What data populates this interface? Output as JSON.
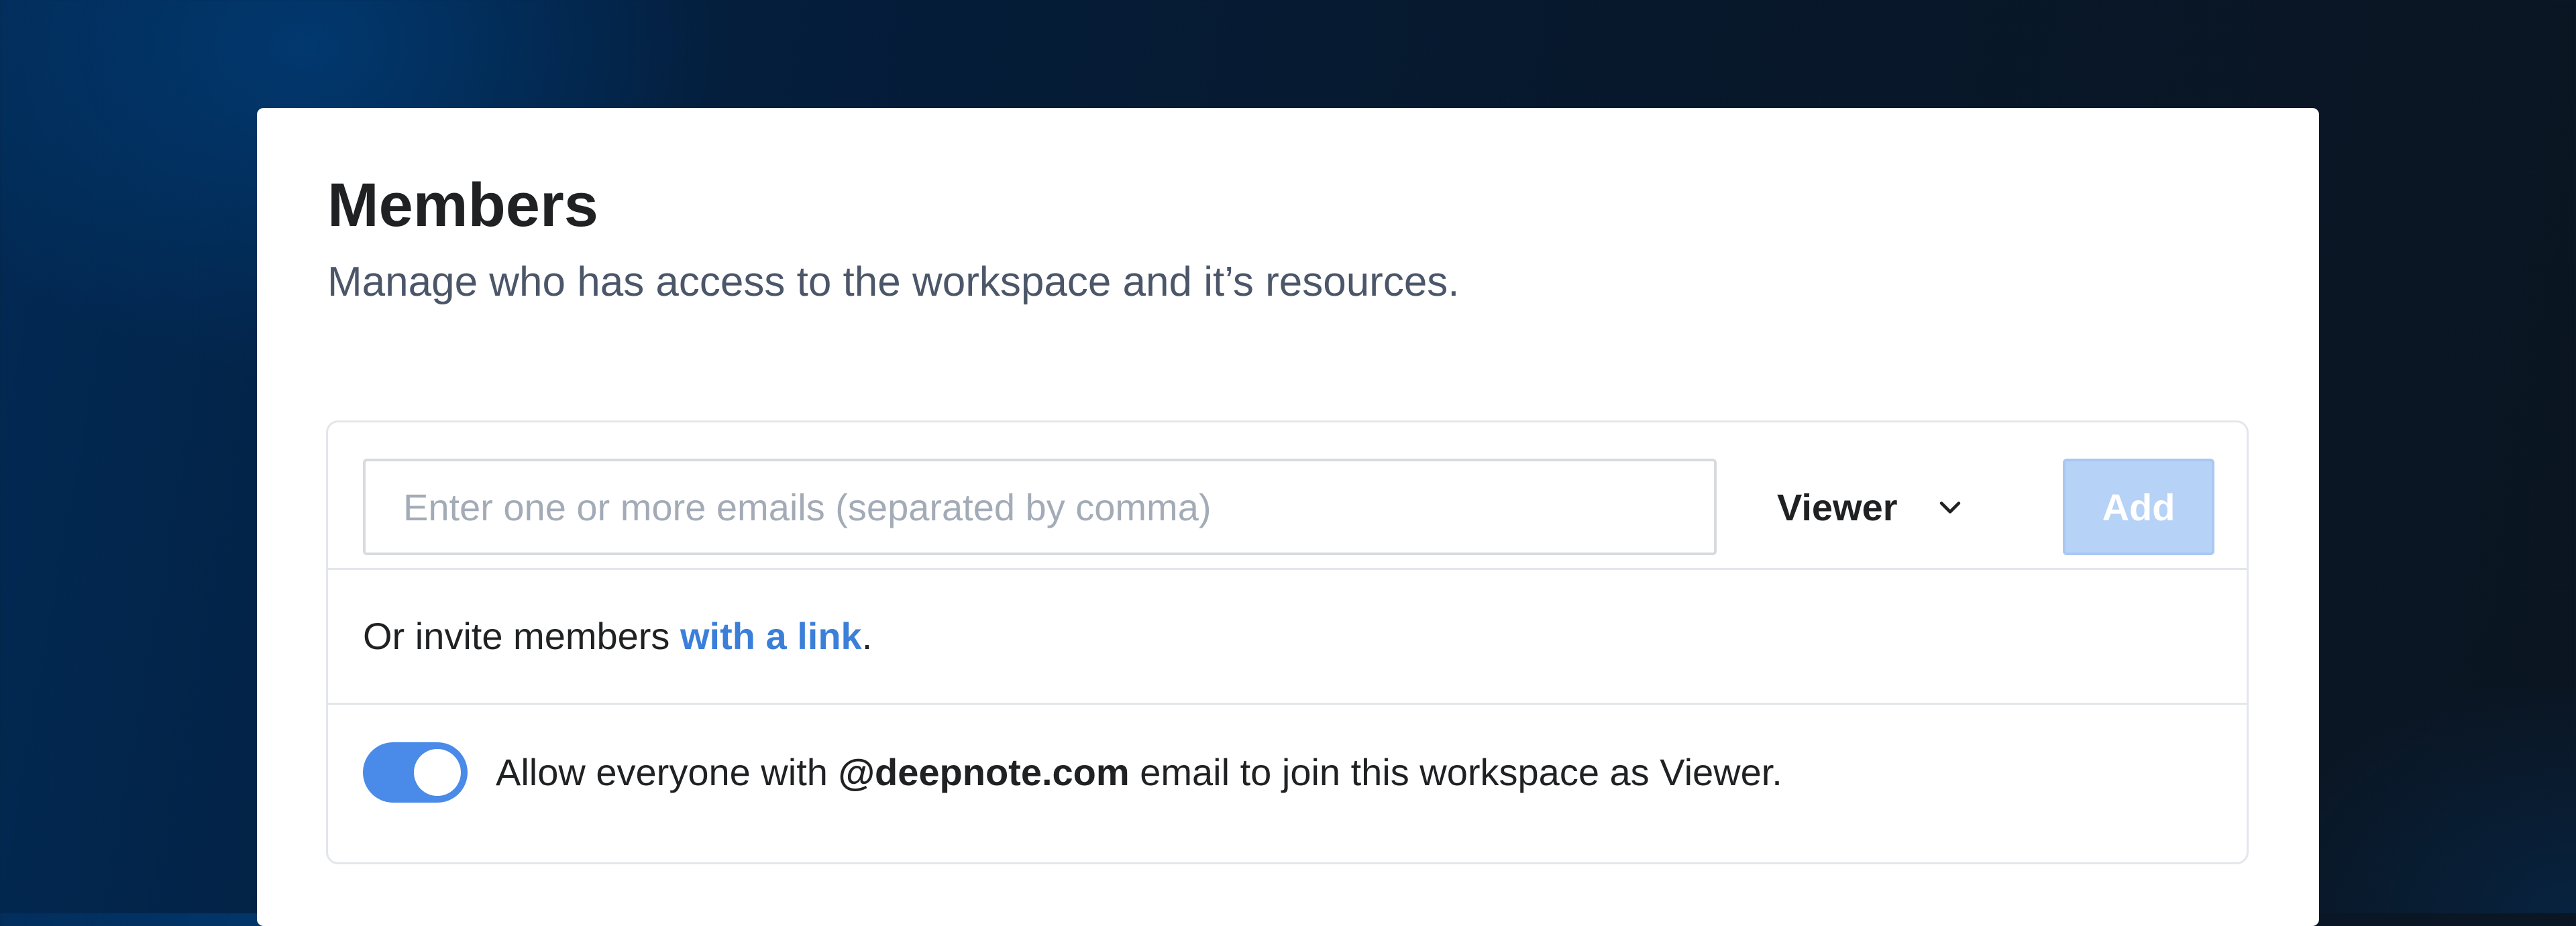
{
  "header": {
    "title": "Members",
    "subtitle": "Manage who has access to the workspace and it’s resources."
  },
  "invite": {
    "email_placeholder": "Enter one or more emails (separated by comma)",
    "email_value": "",
    "role_selected": "Viewer",
    "add_label": "Add"
  },
  "link_invite": {
    "prefix": "Or invite members ",
    "link_text": "with a link",
    "suffix": "."
  },
  "domain_join": {
    "enabled": true,
    "prefix": "Allow everyone with ",
    "domain": "@deepnote.com",
    "suffix": " email to join this workspace as Viewer."
  },
  "colors": {
    "accent": "#4a8ae8",
    "link": "#3b7fd9",
    "add_button_disabled": "#b6d2f7"
  },
  "icons": {
    "role_dropdown": "chevron-down-icon"
  }
}
